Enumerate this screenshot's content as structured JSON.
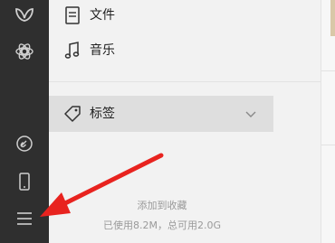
{
  "sidebar_rail": {
    "icons": [
      "logo-butterfly-icon",
      "community-icon",
      "link-icon",
      "phone-icon",
      "menu-icon"
    ]
  },
  "nav": {
    "files_label": "文件",
    "music_label": "音乐",
    "tags_label": "标签"
  },
  "footer": {
    "add_favorites": "添加到收藏",
    "storage_usage": "已使用8.2M，总可用2.0G"
  },
  "colors": {
    "rail_bg": "#2f2f2f",
    "panel_bg": "#f2f2f2",
    "selected_bg": "#dedede",
    "annotation_arrow": "#e8231f"
  }
}
